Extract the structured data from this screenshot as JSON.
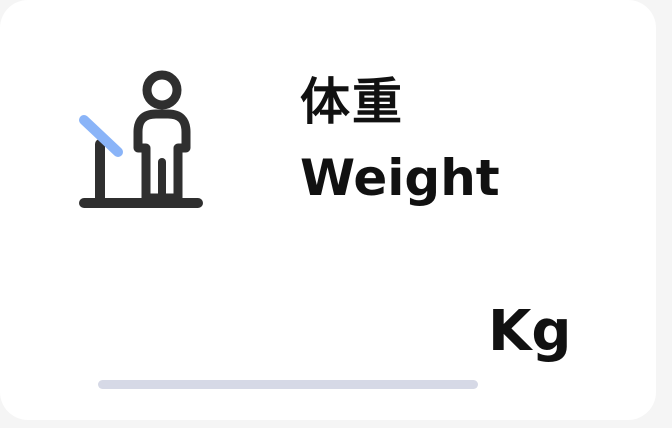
{
  "header": {
    "title_cn": "体重",
    "title_en": "Weight",
    "icon": "scale-person-icon"
  },
  "input": {
    "value": "",
    "unit": "Kg"
  },
  "colors": {
    "icon_stroke": "#2f2f2f",
    "icon_accent": "#8ab4f8",
    "underline": "#d6d9e6",
    "text": "#111111"
  }
}
